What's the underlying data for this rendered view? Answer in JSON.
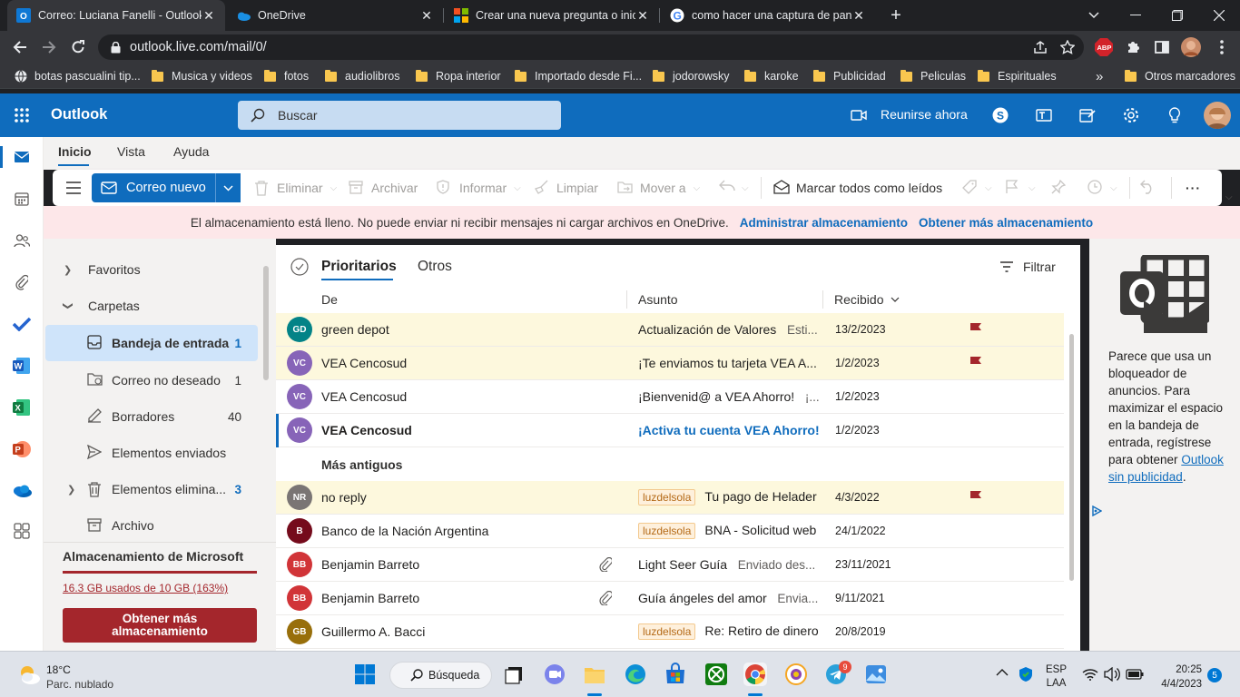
{
  "browser": {
    "tabs": [
      {
        "title": "Correo: Luciana Fanelli - Outlook",
        "favicon": "outlook-icon",
        "active": true
      },
      {
        "title": "OneDrive",
        "favicon": "onedrive-icon"
      },
      {
        "title": "Crear una nueva pregunta o inicia",
        "favicon": "microsoft-icon"
      },
      {
        "title": "como hacer una captura de panta",
        "favicon": "google-icon"
      }
    ],
    "url": "outlook.live.com/mail/0/",
    "bookmarks": [
      "botas pascualini tip...",
      "Musica y videos",
      "fotos",
      "audiolibros",
      "Ropa interior",
      "Importado desde Fi...",
      "jodorowsky",
      "karoke",
      "Publicidad",
      "Peliculas",
      "Espirituales"
    ],
    "more_bookmarks": "»",
    "other_bookmarks": "Otros marcadores",
    "abp_label": "ABP"
  },
  "outlook": {
    "brand": "Outlook",
    "search_placeholder": "Buscar",
    "meet_now": "Reunirse ahora",
    "ribbon_tabs": [
      "Inicio",
      "Vista",
      "Ayuda"
    ],
    "new_mail": "Correo nuevo",
    "actions": {
      "delete": "Eliminar",
      "archive": "Archivar",
      "report": "Informar",
      "sweep": "Limpiar",
      "move": "Mover a",
      "mark_read": "Marcar todos como leídos",
      "more": "···"
    },
    "banner": {
      "text": "El almacenamiento está lleno. No puede enviar ni recibir mensajes ni cargar archivos en OneDrive.",
      "link1": "Administrar almacenamiento",
      "link2": "Obtener más almacenamiento"
    },
    "folders": {
      "favorites": "Favoritos",
      "folders": "Carpetas",
      "items": [
        {
          "name": "Bandeja de entrada",
          "count": "1"
        },
        {
          "name": "Correo no deseado",
          "count": "1"
        },
        {
          "name": "Borradores",
          "count": "40"
        },
        {
          "name": "Elementos enviados",
          "count": ""
        },
        {
          "name": "Elementos elimina...",
          "count": "3"
        },
        {
          "name": "Archivo",
          "count": ""
        }
      ]
    },
    "storage": {
      "title": "Almacenamiento de Microsoft",
      "usage": "16.3 GB usados de 10 GB (163%)",
      "button_line1": "Obtener más",
      "button_line2": "almacenamiento"
    },
    "list": {
      "tab_focused": "Prioritarios",
      "tab_other": "Otros",
      "filter": "Filtrar",
      "col_from": "De",
      "col_subject": "Asunto",
      "col_received": "Recibido",
      "older_header": "Más antiguos",
      "messages": [
        {
          "initials": "GD",
          "color": "#038387",
          "from": "green depot",
          "subject": "Actualización de Valores",
          "preview": "Esti...",
          "date": "13/2/2023",
          "flagged": true
        },
        {
          "initials": "VC",
          "color": "#8764b8",
          "from": "VEA Cencosud",
          "subject": "¡Te enviamos tu tarjeta VEA A...",
          "preview": "",
          "date": "1/2/2023",
          "flagged": true
        },
        {
          "initials": "VC",
          "color": "#8764b8",
          "from": "VEA Cencosud",
          "subject": "¡Bienvenid@ a VEA Ahorro!",
          "preview": "¡...",
          "date": "1/2/2023",
          "flagged": false
        },
        {
          "initials": "VC",
          "color": "#8764b8",
          "from": "VEA Cencosud",
          "subject": "¡Activa tu cuenta VEA Ahorro!",
          "preview": "",
          "date": "1/2/2023",
          "flagged": false,
          "unread": true
        }
      ],
      "older_messages": [
        {
          "initials": "NR",
          "color": "#7a7574",
          "from": "no reply",
          "tag": "luzdelsola",
          "subject": "Tu pago de Helader",
          "date": "4/3/2022",
          "flagged": true
        },
        {
          "initials": "B",
          "color": "#750b1c",
          "from": "Banco de la Nación Argentina",
          "tag": "luzdelsola",
          "subject": "BNA - Solicitud web",
          "date": "24/1/2022",
          "flagged": false
        },
        {
          "initials": "BB",
          "color": "#d13438",
          "from": "Benjamin Barreto",
          "subject": "Light Seer Guía",
          "preview": "Enviado des...",
          "date": "23/11/2021",
          "flagged": false,
          "attachment": true
        },
        {
          "initials": "BB",
          "color": "#d13438",
          "from": "Benjamin Barreto",
          "subject": "Guía ángeles del amor",
          "preview": "Envia...",
          "date": "9/11/2021",
          "flagged": false,
          "attachment": true
        },
        {
          "initials": "GB",
          "color": "#986f0b",
          "from": "Guillermo A. Bacci",
          "tag": "luzdelsola",
          "subject": "Re: Retiro de dinero",
          "date": "20/8/2019",
          "flagged": false
        }
      ]
    },
    "adblock": {
      "text": "Parece que usa un bloqueador de anuncios. Para maximizar el espacio en la bandeja de entrada, regístrese para obtener ",
      "link": "Outlook sin publicidad",
      "end": "."
    }
  },
  "taskbar": {
    "weather_temp": "18°C",
    "weather_desc": "Parc. nublado",
    "search": "Búsqueda",
    "lang1": "ESP",
    "lang2": "LAA",
    "time": "20:25",
    "date": "4/4/2023",
    "notif": "5",
    "telegram_badge": "9"
  }
}
